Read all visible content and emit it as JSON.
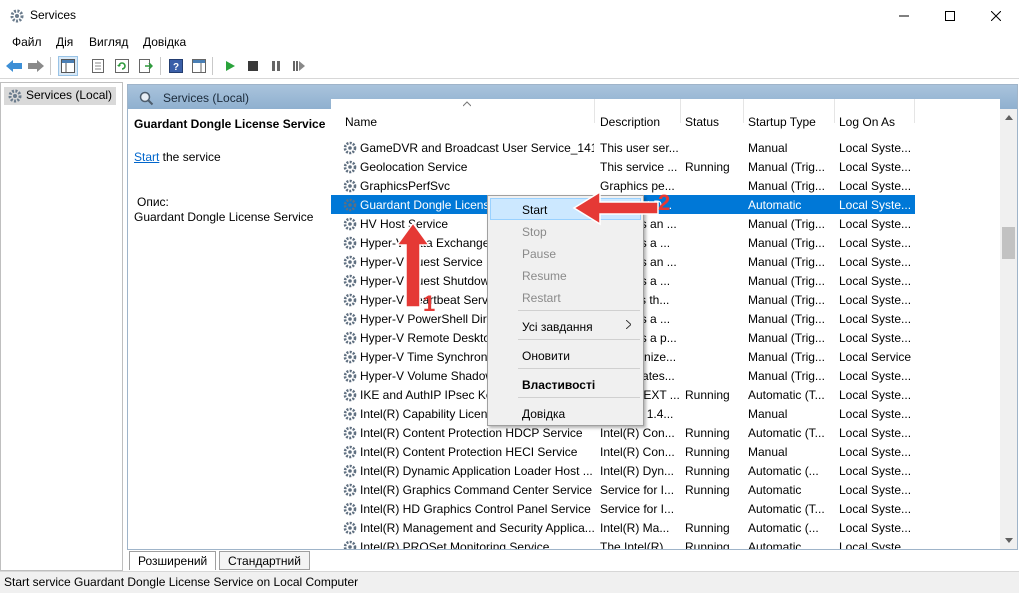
{
  "window": {
    "title": "Services"
  },
  "menu": [
    "Файл",
    "Дія",
    "Вигляд",
    "Довідка"
  ],
  "tree": {
    "root": "Services (Local)"
  },
  "header": {
    "title": "Services (Local)"
  },
  "description": {
    "service_name": "Guardant Dongle License Service",
    "start_link": "Start",
    "start_suffix": " the service",
    "label": "Опис:",
    "text": "Guardant Dongle License Service"
  },
  "columns": {
    "name": "Name",
    "description": "Description",
    "status": "Status",
    "startup": "Startup Type",
    "logon": "Log On As"
  },
  "services": [
    {
      "name": "GameDVR and Broadcast User Service_141...",
      "desc": "This user ser...",
      "status": "",
      "startup": "Manual",
      "logon": "Local Syste..."
    },
    {
      "name": "Geolocation Service",
      "desc": "This service ...",
      "status": "Running",
      "startup": "Manual (Trig...",
      "logon": "Local Syste..."
    },
    {
      "name": "GraphicsPerfSvc",
      "desc": "Graphics pe...",
      "status": "",
      "startup": "Manual (Trig...",
      "logon": "Local Syste..."
    },
    {
      "name": "Guardant Dongle License Service",
      "desc": "Guardant D...",
      "status": "",
      "startup": "Automatic",
      "logon": "Local Syste...",
      "selected": true
    },
    {
      "name": "HV Host Service",
      "desc": "Provides an ...",
      "status": "",
      "startup": "Manual (Trig...",
      "logon": "Local Syste..."
    },
    {
      "name": "Hyper-V Data Exchange Service",
      "desc": "Provides a ...",
      "status": "",
      "startup": "Manual (Trig...",
      "logon": "Local Syste..."
    },
    {
      "name": "Hyper-V Guest Service Interface",
      "desc": "Provides an ...",
      "status": "",
      "startup": "Manual (Trig...",
      "logon": "Local Syste..."
    },
    {
      "name": "Hyper-V Guest Shutdown Service",
      "desc": "Provides a ...",
      "status": "",
      "startup": "Manual (Trig...",
      "logon": "Local Syste..."
    },
    {
      "name": "Hyper-V Heartbeat Service",
      "desc": "Monitors th...",
      "status": "",
      "startup": "Manual (Trig...",
      "logon": "Local Syste..."
    },
    {
      "name": "Hyper-V PowerShell Direct Service",
      "desc": "Provides a ...",
      "status": "",
      "startup": "Manual (Trig...",
      "logon": "Local Syste..."
    },
    {
      "name": "Hyper-V Remote Desktop Virtualization...",
      "desc": "Provides a p...",
      "status": "",
      "startup": "Manual (Trig...",
      "logon": "Local Syste..."
    },
    {
      "name": "Hyper-V Time Synchronization Service",
      "desc": "Synchronize...",
      "status": "",
      "startup": "Manual (Trig...",
      "logon": "Local Service"
    },
    {
      "name": "Hyper-V Volume Shadow Copy Requestor",
      "desc": "Coordinates...",
      "status": "",
      "startup": "Manual (Trig...",
      "logon": "Local Syste..."
    },
    {
      "name": "IKE and AuthIP IPsec Keying Modules",
      "desc": "The IKEEXT ...",
      "status": "Running",
      "startup": "Automatic (T...",
      "logon": "Local Syste..."
    },
    {
      "name": "Intel(R) Capability Licensing Service",
      "desc": "Version: 1.4...",
      "status": "",
      "startup": "Manual",
      "logon": "Local Syste..."
    },
    {
      "name": "Intel(R) Content Protection HDCP Service",
      "desc": "Intel(R) Con...",
      "status": "Running",
      "startup": "Automatic (T...",
      "logon": "Local Syste..."
    },
    {
      "name": "Intel(R) Content Protection HECI Service",
      "desc": "Intel(R) Con...",
      "status": "Running",
      "startup": "Manual",
      "logon": "Local Syste..."
    },
    {
      "name": "Intel(R) Dynamic Application Loader Host ...",
      "desc": "Intel(R) Dyn...",
      "status": "Running",
      "startup": "Automatic (...",
      "logon": "Local Syste..."
    },
    {
      "name": "Intel(R) Graphics Command Center Service",
      "desc": "Service for I...",
      "status": "Running",
      "startup": "Automatic",
      "logon": "Local Syste..."
    },
    {
      "name": "Intel(R) HD Graphics Control Panel Service",
      "desc": "Service for I...",
      "status": "",
      "startup": "Automatic (T...",
      "logon": "Local Syste..."
    },
    {
      "name": "Intel(R) Management and Security Applica...",
      "desc": "Intel(R) Ma...",
      "status": "Running",
      "startup": "Automatic (...",
      "logon": "Local Syste..."
    },
    {
      "name": "Intel(R) PROSet Monitoring Service",
      "desc": "The Intel(R) ...",
      "status": "Running",
      "startup": "Automatic",
      "logon": "Local Syste..."
    }
  ],
  "context_menu": {
    "start": "Start",
    "stop": "Stop",
    "pause": "Pause",
    "resume": "Resume",
    "restart": "Restart",
    "all_tasks": "Усі завдання",
    "refresh": "Оновити",
    "properties": "Властивості",
    "help": "Довідка"
  },
  "tabs": {
    "extended": "Розширений",
    "standard": "Стандартний"
  },
  "status_bar": "Start service Guardant Dongle License Service on Local Computer",
  "annotations": {
    "label_1": "1",
    "label_2": "2",
    "color": "#e53935"
  },
  "colors": {
    "selection": "#0078d7",
    "header": "#97b5d3",
    "menu_hover": "#cce8ff"
  }
}
